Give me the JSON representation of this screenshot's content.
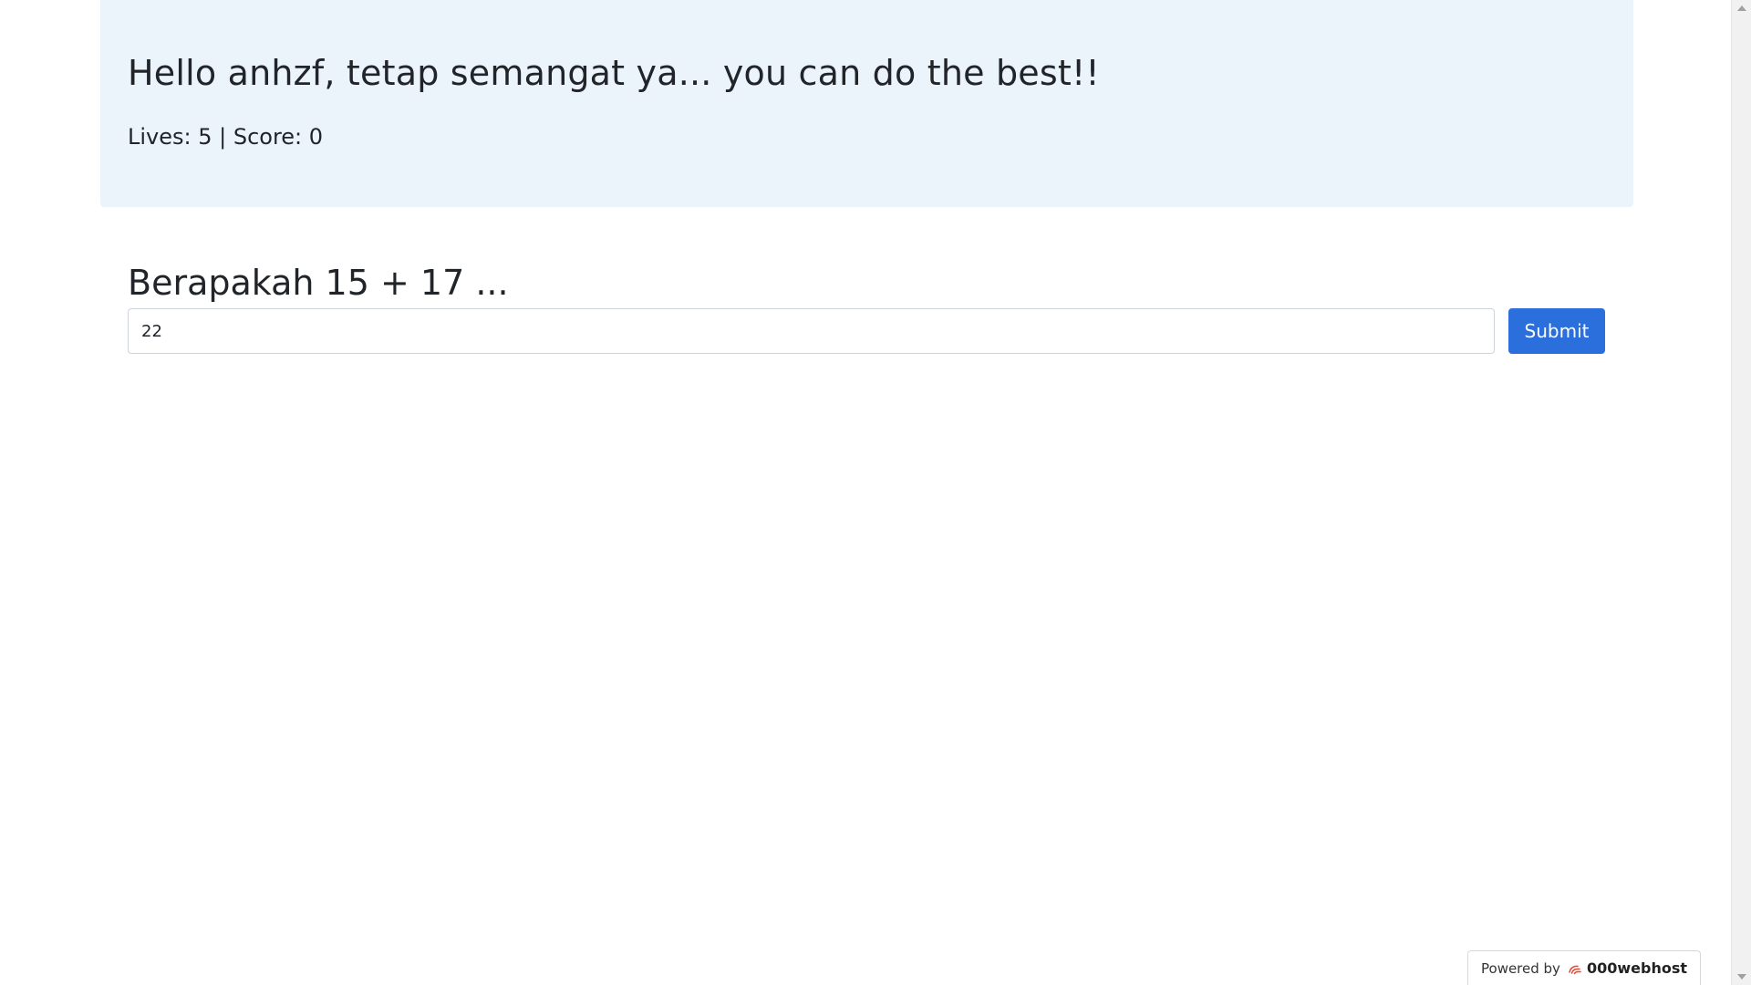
{
  "header": {
    "greeting": "Hello anhzf, tetap semangat ya... you can do the best!!",
    "stats": "Lives: 5 | Score: 0"
  },
  "quiz": {
    "question": "Berapakah 15 + 17 ...",
    "answer_value": "22",
    "submit_label": "Submit"
  },
  "footer": {
    "powered_label": "Powered by",
    "brand_name": "000webhost",
    "brand_icon": "000webhost-logo-icon"
  },
  "colors": {
    "hero_bg": "#ecf4fb",
    "primary_button": "#2a6fdb",
    "brand_red": "#e8432f"
  }
}
